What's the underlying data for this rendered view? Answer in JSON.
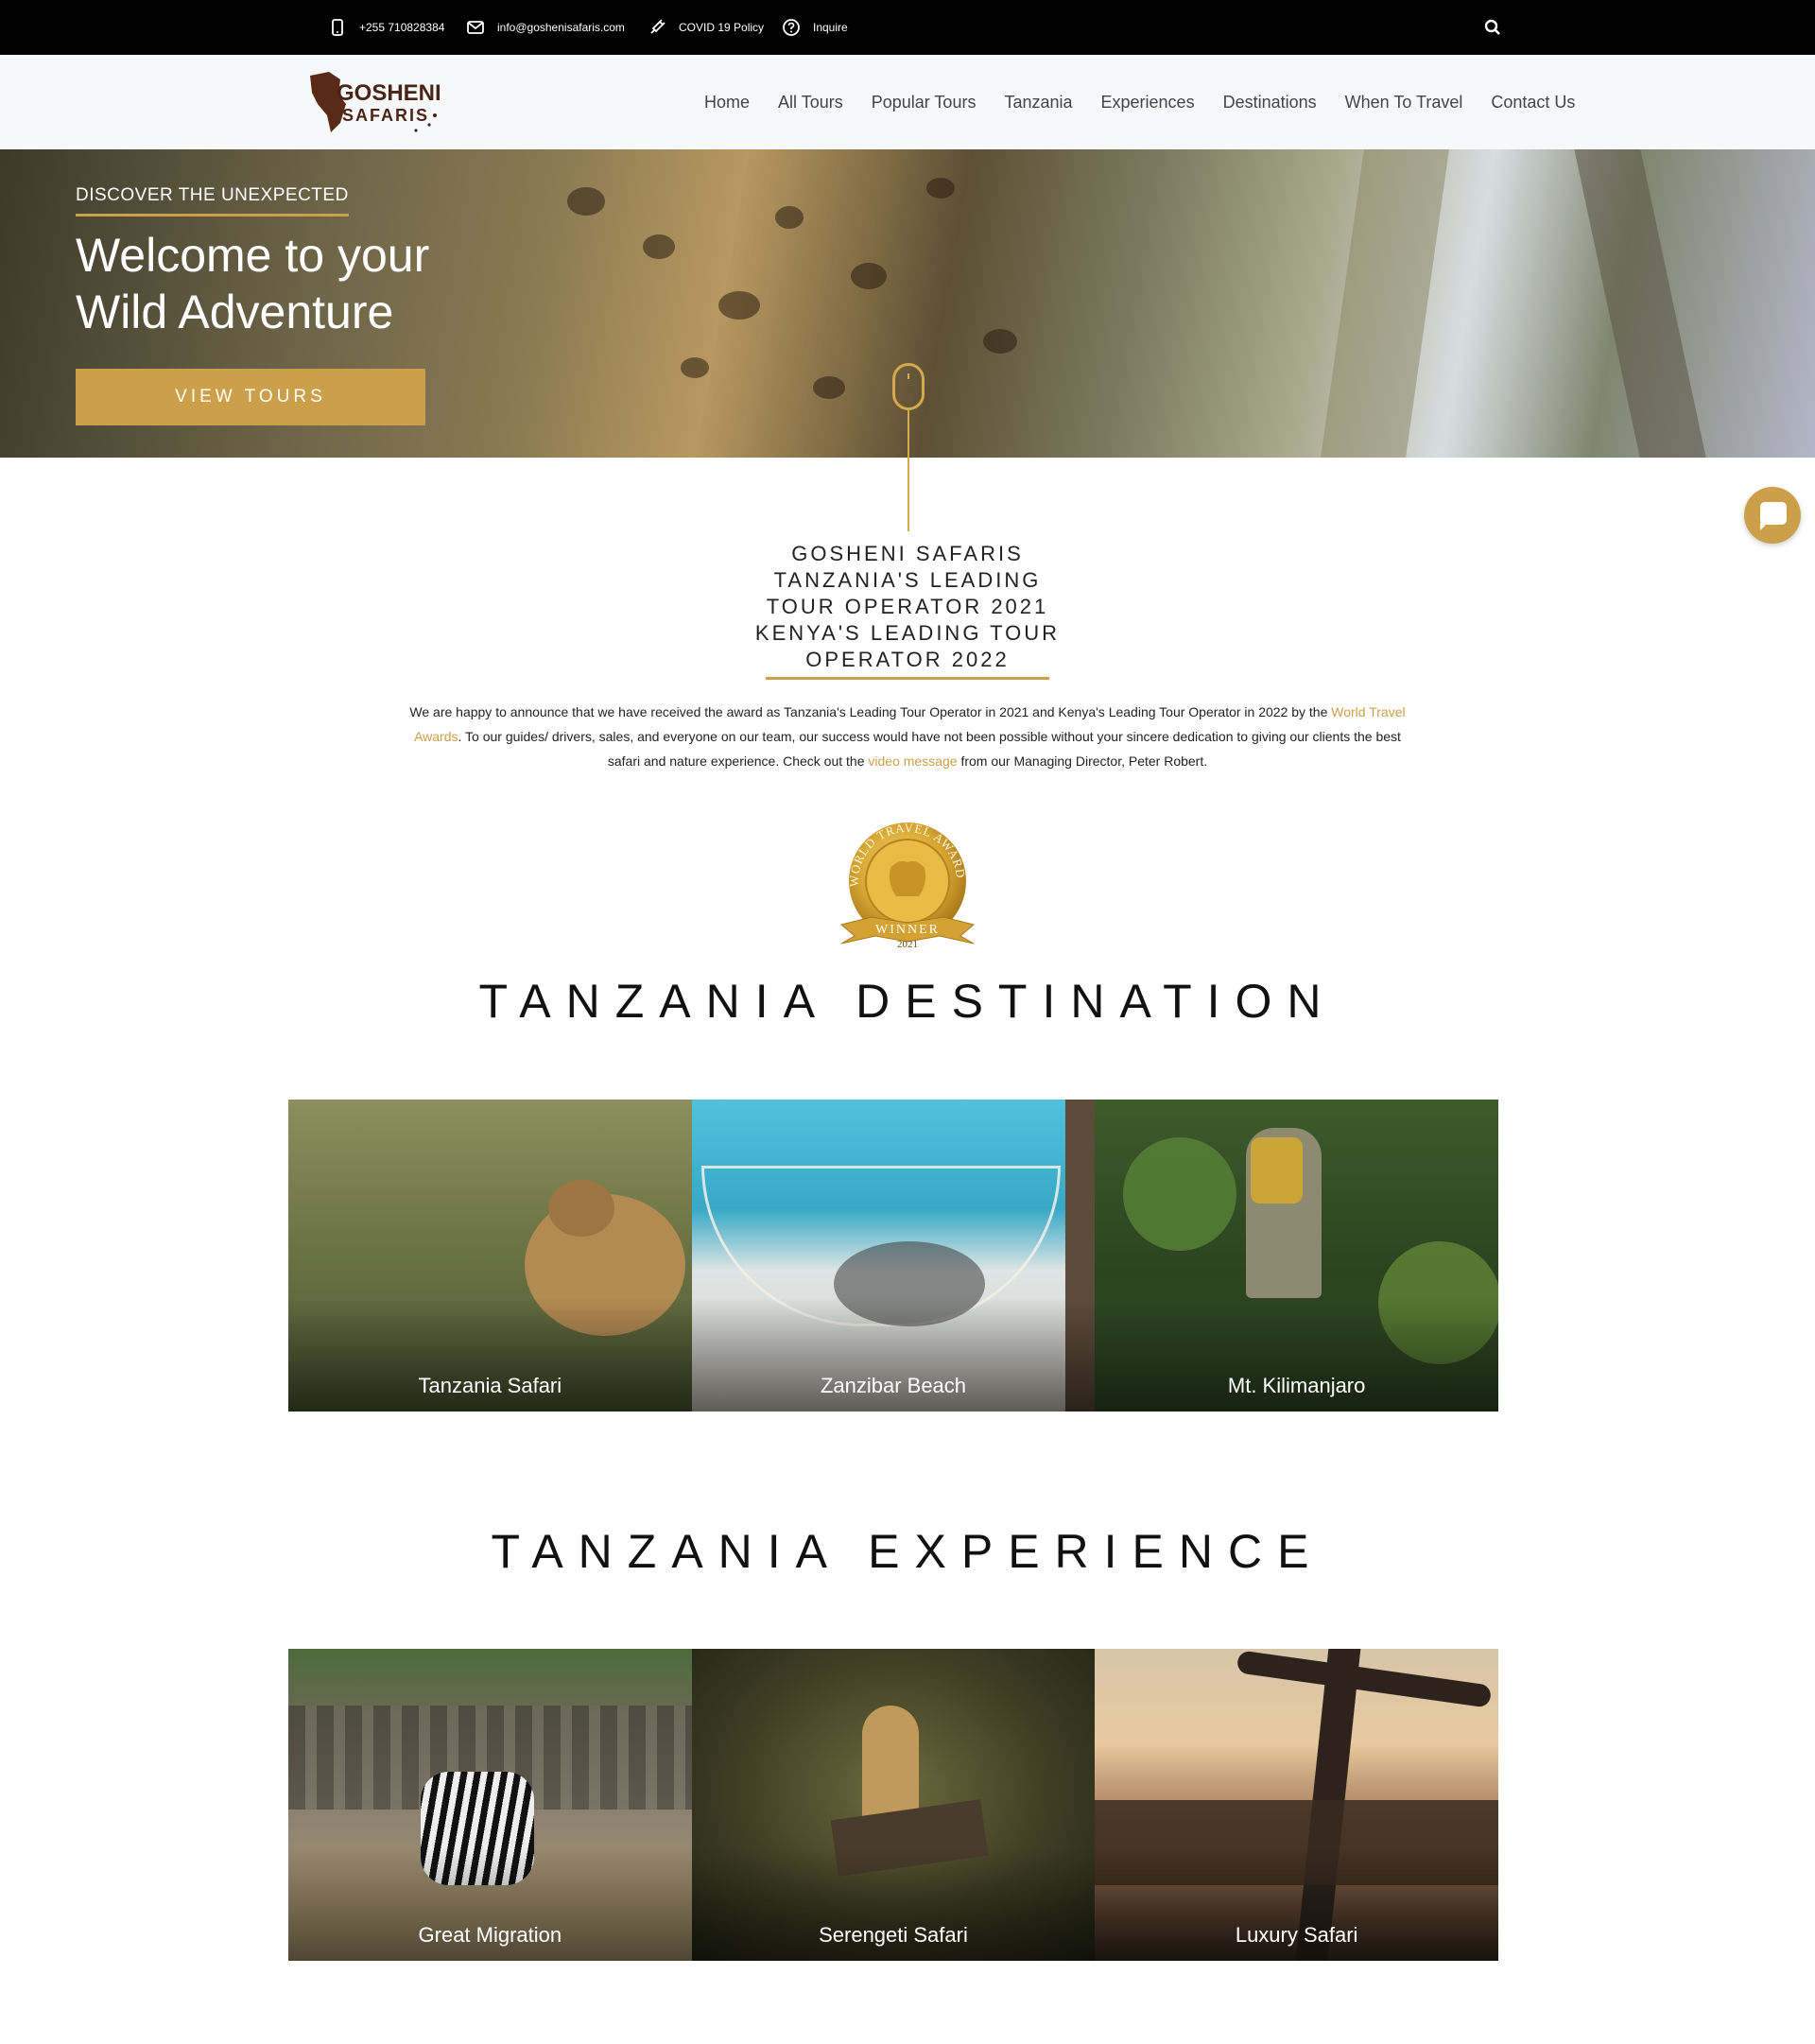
{
  "topbar": {
    "phone": "+255 710828384",
    "email": "info@goshenisafaris.com",
    "covid": "COVID 19 Policy",
    "inquire": "Inquire"
  },
  "logo": {
    "line1": "GOSHENI",
    "line2": "SAFARIS"
  },
  "nav": [
    "Home",
    "All Tours",
    "Popular Tours",
    "Tanzania",
    "Experiences",
    "Destinations",
    "When To Travel",
    "Contact Us"
  ],
  "hero": {
    "kicker": "DISCOVER THE UNEXPECTED",
    "title": "Welcome to your Wild Adventure",
    "button": "VIEW TOURS"
  },
  "award": {
    "heading_lines": [
      "GOSHENI SAFARIS",
      "TANZANIA'S LEADING",
      "TOUR OPERATOR 2021",
      "KENYA'S LEADING TOUR",
      "OPERATOR 2022"
    ],
    "text_1": "We are happy to announce that we have received the award as Tanzania's Leading Tour Operator in 2021 and Kenya's Leading Tour Operator in 2022 by the ",
    "link_1": "World Travel Awards",
    "text_2": ". To our guides/ drivers, sales, and everyone on our team, our success would have not been possible without your sincere dedication to giving our clients the best safari and nature experience. Check out the ",
    "link_2": "video message",
    "text_3": " from our Managing Director, Peter Robert.",
    "badge": {
      "top": "WORLD TRAVEL AWARDS",
      "ribbon": "WINNER",
      "year": "2021"
    }
  },
  "destination": {
    "title": "TANZANIA DESTINATION",
    "cards": [
      "Tanzania Safari",
      "Zanzibar Beach",
      "Mt. Kilimanjaro"
    ]
  },
  "experience": {
    "title": "TANZANIA EXPERIENCE",
    "cards": [
      "Great Migration",
      "Serengeti Safari",
      "Luxury Safari"
    ]
  },
  "colors": {
    "accent": "#cc9f4a",
    "topbar": "#000000",
    "header": "#f7f8f9"
  },
  "icons": [
    "phone-icon",
    "mail-icon",
    "syringe-icon",
    "question-icon",
    "search-icon",
    "chat-icon"
  ]
}
